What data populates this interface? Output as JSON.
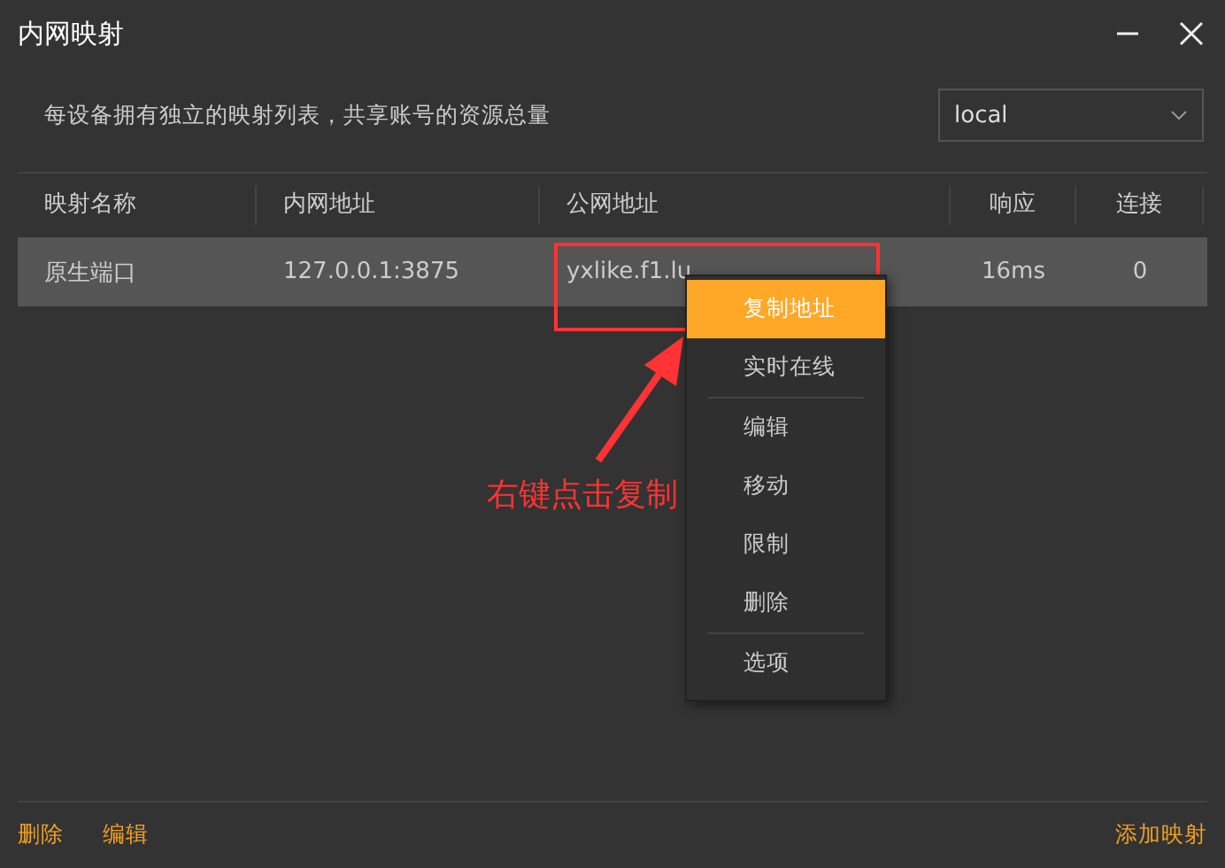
{
  "window": {
    "title": "内网映射"
  },
  "description": "每设备拥有独立的映射列表，共享账号的资源总量",
  "device_select": {
    "value": "local"
  },
  "table": {
    "columns": [
      "映射名称",
      "内网地址",
      "公网地址",
      "响应",
      "连接"
    ],
    "rows": [
      {
        "cells": [
          "原生端口",
          "127.0.0.1:3875",
          "yxlike.f1.lu",
          "16ms",
          "0"
        ],
        "selected": true
      }
    ]
  },
  "context_menu": [
    {
      "kind": "item",
      "label": "复制地址",
      "selected": true
    },
    {
      "kind": "item",
      "label": "实时在线",
      "selected": false
    },
    {
      "kind": "separator"
    },
    {
      "kind": "item",
      "label": "编辑",
      "selected": false
    },
    {
      "kind": "item",
      "label": "移动",
      "selected": false
    },
    {
      "kind": "item",
      "label": "限制",
      "selected": false
    },
    {
      "kind": "item",
      "label": "删除",
      "selected": false
    },
    {
      "kind": "separator"
    },
    {
      "kind": "item",
      "label": "选项",
      "selected": false
    }
  ],
  "annotation": {
    "text": "右键点击复制"
  },
  "footer": {
    "left_buttons": [
      "删除",
      "编辑"
    ],
    "right_button": "添加映射"
  }
}
